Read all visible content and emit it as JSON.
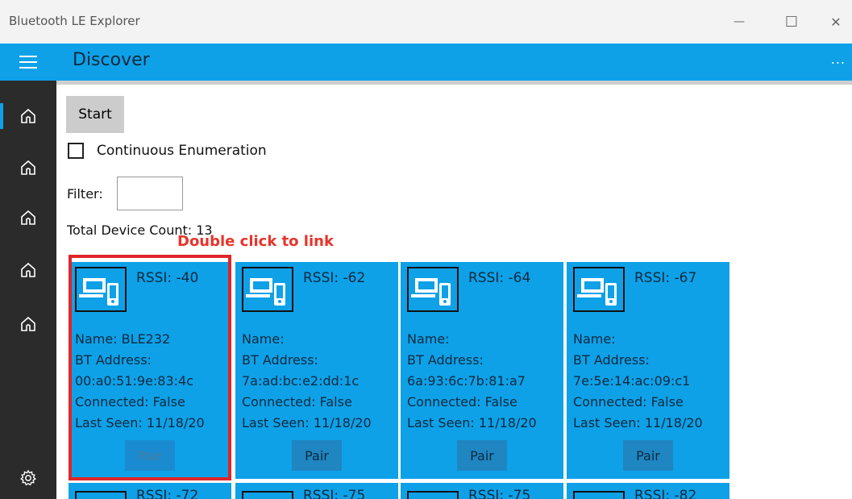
{
  "window": {
    "title": "Bluetooth LE Explorer",
    "minimize_glyph": "—",
    "maximize_glyph": "☐",
    "close_glyph": "✕"
  },
  "header": {
    "title": "Discover",
    "more_glyph": "..."
  },
  "controls": {
    "start_label": "Start",
    "continuous_label": "Continuous Enumeration",
    "continuous_checked": false,
    "filter_label": "Filter:",
    "filter_value": "",
    "device_count_text": "Total Device Count: 13"
  },
  "annotation": {
    "text": "Double click to link",
    "color": "#e0252a"
  },
  "colors": {
    "accent": "#0ea1e8",
    "sidebar": "#2b2b2b"
  },
  "devices": [
    {
      "rssi": "RSSI: -40",
      "name": "Name: BLE232",
      "bt_address_label": "BT Address:",
      "bt_address": "00:a0:51:9e:83:4c",
      "connected": "Connected: False",
      "last_seen": "Last Seen: 11/18/20",
      "pair_label": "Pair"
    },
    {
      "rssi": "RSSI: -62",
      "name": "Name:",
      "bt_address_label": "BT Address:",
      "bt_address": "7a:ad:bc:e2:dd:1c",
      "connected": "Connected: False",
      "last_seen": "Last Seen: 11/18/20",
      "pair_label": "Pair"
    },
    {
      "rssi": "RSSI: -64",
      "name": "Name:",
      "bt_address_label": "BT Address:",
      "bt_address": "6a:93:6c:7b:81:a7",
      "connected": "Connected: False",
      "last_seen": "Last Seen: 11/18/20",
      "pair_label": "Pair"
    },
    {
      "rssi": "RSSI: -67",
      "name": "Name:",
      "bt_address_label": "BT Address:",
      "bt_address": "7e:5e:14:ac:09:c1",
      "connected": "Connected: False",
      "last_seen": "Last Seen: 11/18/20",
      "pair_label": "Pair"
    }
  ],
  "partial_row": [
    {
      "rssi": "RSSI: -72"
    },
    {
      "rssi": "RSSI: -75"
    },
    {
      "rssi": "RSSI: -75"
    },
    {
      "rssi": "RSSI: -82"
    }
  ],
  "icons": {
    "nav": [
      "home-icon",
      "home-icon",
      "home-icon",
      "home-icon",
      "home-icon"
    ],
    "settings": "gear-icon",
    "device": "computer-phone-icon",
    "menu": "hamburger-menu-icon"
  }
}
